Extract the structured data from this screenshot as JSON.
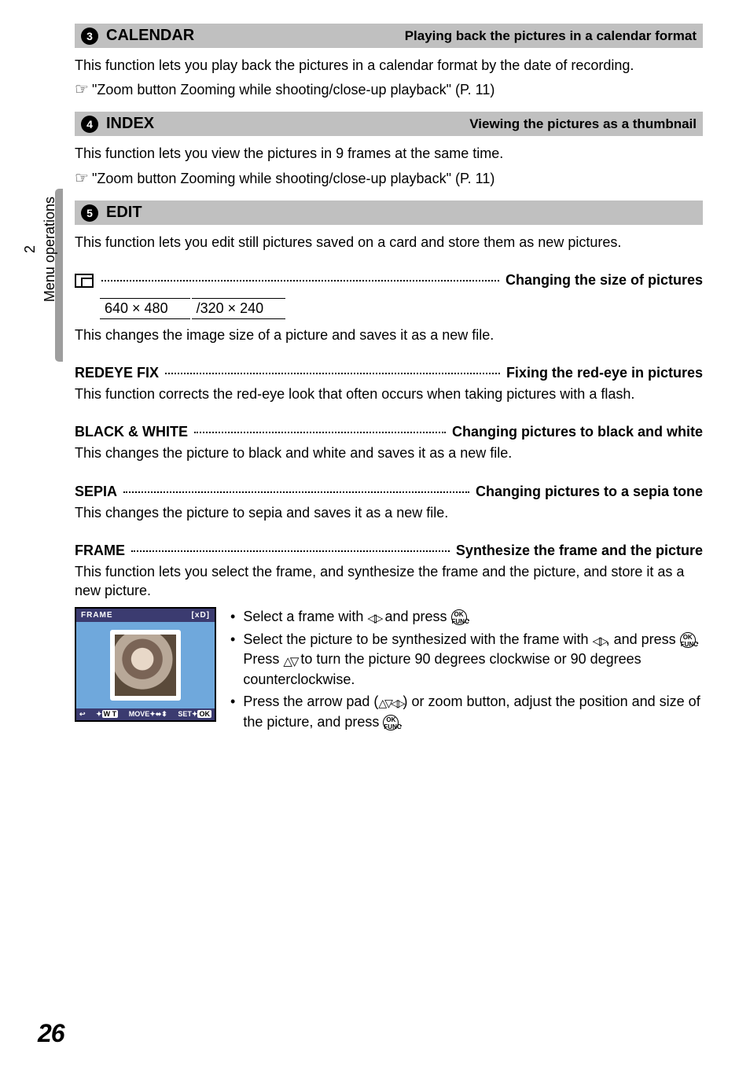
{
  "page_number": "26",
  "side": {
    "chapter_num": "2",
    "label": "Menu operations"
  },
  "sec3": {
    "num": "3",
    "title": "CALENDAR",
    "subtitle": "Playing back the pictures in a calendar format",
    "body": "This function lets you play back the pictures in a calendar format by the date of recording.",
    "xref": "\"Zoom button  Zooming while shooting/close-up playback\" (P. 11)"
  },
  "sec4": {
    "num": "4",
    "title": "INDEX",
    "subtitle": "Viewing the pictures as a thumbnail",
    "body": "This function lets you view the pictures in 9 frames at the same time.",
    "xref": "\"Zoom button  Zooming while shooting/close-up playback\" (P. 11)"
  },
  "sec5": {
    "num": "5",
    "title": "EDIT",
    "body": "This function lets you edit still pictures saved on a card and store them as new pictures."
  },
  "resize": {
    "tail": "Changing the size of pictures",
    "opt1": "640 × 480",
    "opt2": "/320 × 240",
    "body": "This changes the image size of a picture and saves it as a new file."
  },
  "redeye": {
    "lead": "REDEYE FIX",
    "tail": "Fixing the red-eye in pictures",
    "body": "This function corrects the red-eye look that often occurs when taking pictures with a flash."
  },
  "bw": {
    "lead": "BLACK & WHITE",
    "tail": "Changing pictures to black and white",
    "body": "This changes the picture to black and white and saves it as a new file."
  },
  "sepia": {
    "lead": "SEPIA",
    "tail": "Changing pictures to a sepia tone",
    "body": "This changes the picture to sepia and saves it as a new file."
  },
  "frame": {
    "lead": "FRAME",
    "tail": "Synthesize the frame and the picture",
    "body": "This function lets you select the frame, and synthesize the frame and the picture, and store it as a new picture.",
    "ui_top_left": "FRAME",
    "ui_top_right": "[xD]",
    "ui_bot_left_icon": "↩",
    "ui_bot_wt": "W T",
    "ui_bot_move": "MOVE✦⬌⬍",
    "ui_bot_set": "SET✦",
    "ui_bot_ok": "OK",
    "step1a": "Select a frame with ",
    "step1b": " and press ",
    "step1c": ".",
    "step2a": "Select the picture to be synthesized with the frame with ",
    "step2b": ", and press ",
    "step2c": ". Press ",
    "step2d": " to turn the picture 90 degrees clockwise or 90 degrees counterclockwise.",
    "step3a": "Press the arrow pad (",
    "step3b": ") or zoom button, adjust the position and size of the picture, and press ",
    "step3c": ".",
    "ok_label": "OK\nFUNC"
  }
}
